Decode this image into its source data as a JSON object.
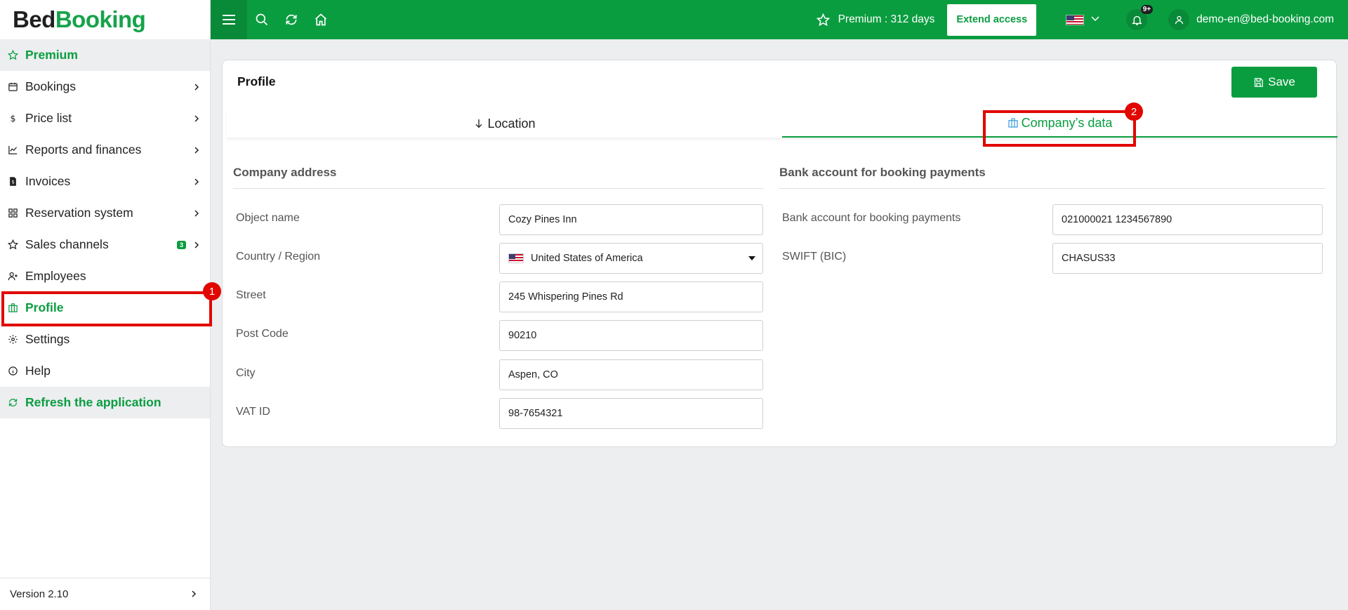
{
  "brand": {
    "part1": "Bed",
    "part2": "Booking"
  },
  "sidebar": {
    "items": [
      {
        "label": "Premium"
      },
      {
        "label": "Bookings"
      },
      {
        "label": "Price list"
      },
      {
        "label": "Reports and finances"
      },
      {
        "label": "Invoices"
      },
      {
        "label": "Reservation system"
      },
      {
        "label": "Sales channels",
        "badge": "3"
      },
      {
        "label": "Employees"
      },
      {
        "label": "Profile"
      },
      {
        "label": "Settings"
      },
      {
        "label": "Help"
      },
      {
        "label": "Refresh the application"
      }
    ],
    "version": "Version 2.10"
  },
  "topbar": {
    "premium_text": "Premium : 312 days",
    "extend_label": "Extend access",
    "notif_count": "9+",
    "user_email": "demo-en@bed-booking.com"
  },
  "annotations": {
    "marker1": "1",
    "marker2": "2",
    "color": "#e10600"
  },
  "page": {
    "title": "Profile",
    "save_label": "Save",
    "tabs": [
      {
        "label": "Location"
      },
      {
        "label": "Company’s data"
      }
    ],
    "active_tab": "Company’s data"
  },
  "company_address": {
    "title": "Company address",
    "fields": [
      {
        "label": "Object name",
        "value": "Cozy Pines Inn"
      },
      {
        "label": "Country / Region",
        "value": "United States of America"
      },
      {
        "label": "Street",
        "value": "245 Whispering Pines Rd"
      },
      {
        "label": "Post Code",
        "value": "90210"
      },
      {
        "label": "City",
        "value": "Aspen, CO"
      },
      {
        "label": "VAT ID",
        "value": "98-7654321"
      }
    ]
  },
  "bank": {
    "title": "Bank account for booking payments",
    "fields": [
      {
        "label": "Bank account for booking payments",
        "value": "021000021 1234567890"
      },
      {
        "label": "SWIFT (BIC)",
        "value": "CHASUS33"
      }
    ]
  },
  "colors": {
    "accent": "#0a9d40",
    "accent_dark": "#088a38",
    "background": "#eceef0"
  }
}
